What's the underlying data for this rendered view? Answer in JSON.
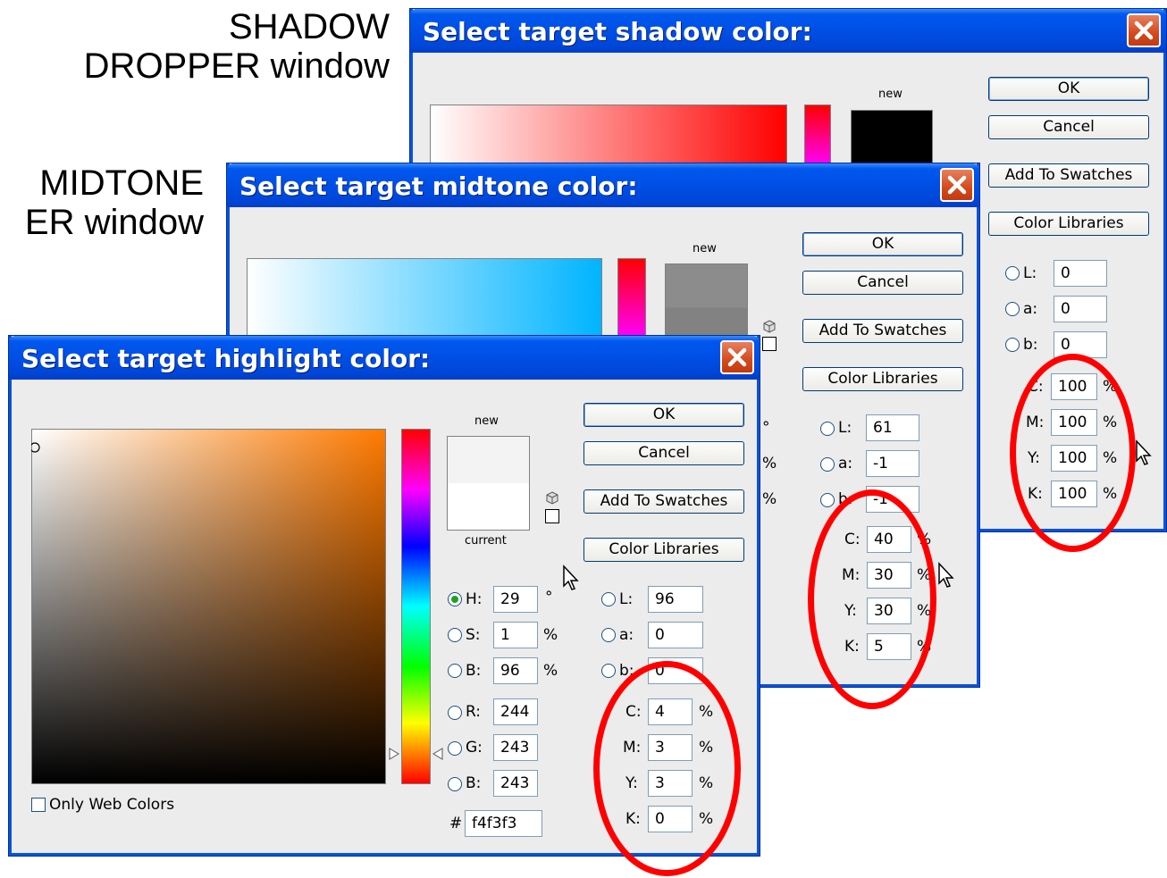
{
  "captions": {
    "shadow": [
      "SHADOW",
      "DROPPER window"
    ],
    "midtone": [
      "MIDTONE",
      "ER window"
    ]
  },
  "common": {
    "ok": "OK",
    "cancel": "Cancel",
    "add_swatches": "Add To Swatches",
    "color_libraries": "Color Libraries",
    "new": "new",
    "current": "current",
    "only_web": "Only Web Colors",
    "pct": "%",
    "deg": "°",
    "hash": "#"
  },
  "shadow": {
    "title": "Select target shadow color:",
    "lab": {
      "L": "0",
      "a": "0",
      "b": "0"
    },
    "cmyk": {
      "C": "100",
      "M": "100",
      "Y": "100",
      "K": "100"
    },
    "labels": {
      "L": "L:",
      "a": "a:",
      "b": "b:",
      "C": "C:",
      "M": "M:",
      "Y": "Y:",
      "K": "K:"
    }
  },
  "midtone": {
    "title": "Select target midtone color:",
    "lab": {
      "L": "61",
      "a": "-1",
      "b": "-1"
    },
    "cmyk": {
      "C": "40",
      "M": "30",
      "Y": "30",
      "K": "5"
    },
    "labels": {
      "L": "L:",
      "a": "a:",
      "b": "b:",
      "C": "C:",
      "M": "M:",
      "Y": "Y:",
      "K": "K:"
    }
  },
  "highlight": {
    "title": "Select target highlight color:",
    "hsb": {
      "H": "29",
      "S": "1",
      "B": "96"
    },
    "rgb": {
      "R": "244",
      "G": "243",
      "B": "243"
    },
    "lab": {
      "L": "96",
      "a": "0",
      "b": "0"
    },
    "cmyk": {
      "C": "4",
      "M": "3",
      "Y": "3",
      "K": "0"
    },
    "hex": "f4f3f3",
    "labels": {
      "H": "H:",
      "S": "S:",
      "Bv": "B:",
      "R": "R:",
      "G": "G:",
      "Bc": "B:",
      "L": "L:",
      "a": "a:",
      "b": "b:",
      "C": "C:",
      "M": "M:",
      "Y": "Y:",
      "K": "K:"
    }
  },
  "icons": {
    "close": "close-icon",
    "cube": "web-safe-cube-icon",
    "cursor": "mouse-pointer-icon"
  },
  "colors": {
    "titlebar": "#0054e3",
    "close": "#d34a1d",
    "highlight_ring": "#ff0000",
    "dialog_bg": "#ececec"
  }
}
